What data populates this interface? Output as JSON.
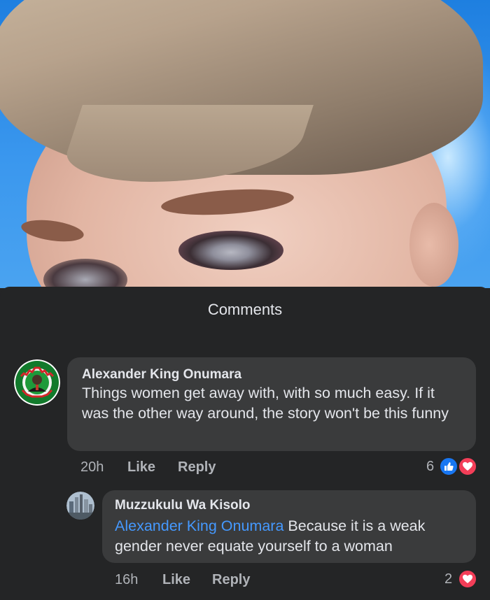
{
  "sheet": {
    "title": "Comments"
  },
  "comments": [
    {
      "author": "Alexander King Onumara",
      "text": "Things women get away with, with so much easy. If it was the other way around, the story won't be this funny",
      "time": "20h",
      "like_label": "Like",
      "reply_label": "Reply",
      "reaction_count": "6",
      "reactions": [
        "like-icon",
        "love-icon"
      ],
      "avatar_badge_text": [
        "CONFIRMED",
        "ODI-DIEN"
      ]
    },
    {
      "author": "Muzzukulu Wa Kisolo",
      "mention": "Alexander King Onumara",
      "text": " Because it is a weak gender never equate yourself to a woman",
      "time": "16h",
      "like_label": "Like",
      "reply_label": "Reply",
      "reaction_count": "2",
      "reactions": [
        "love-icon"
      ]
    }
  ],
  "colors": {
    "sheet_bg": "#242526",
    "bubble_bg": "#3a3b3c",
    "text": "#e4e6eb",
    "meta": "#b0b3b8",
    "mention": "#4599ff",
    "like": "#1877f2",
    "love": "#f33e58"
  }
}
